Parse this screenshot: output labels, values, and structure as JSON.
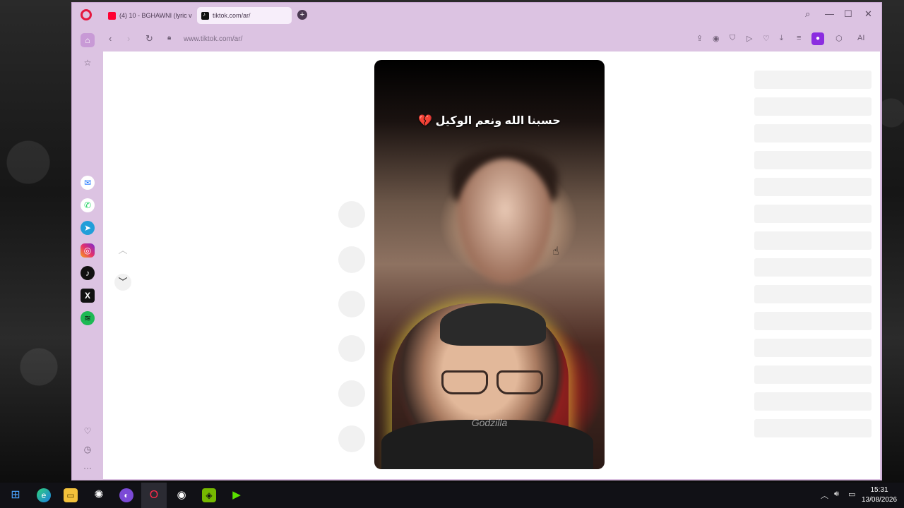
{
  "browser": {
    "tabs": [
      {
        "label": "(4) 10 - BGHAWNI (lyric v",
        "icon": "youtube-icon",
        "active": false
      },
      {
        "label": "tiktok.com/ar/",
        "icon": "tiktok-icon",
        "active": true
      }
    ],
    "new_tab_symbol": "+",
    "url": "www.tiktok.com/ar/",
    "ai_label": "AI"
  },
  "video": {
    "caption": "حسبنا الله ونعم الوكيل 💔",
    "watermark": "Godzilla"
  },
  "taskbar": {
    "time": "15:31",
    "date": "13/08/2026"
  },
  "colors": {
    "browser_frame": "#dcc3e2",
    "opera_red": "#e5173f",
    "profile_purple": "#8b2de0",
    "video_shirt_red": "#c0302a"
  }
}
